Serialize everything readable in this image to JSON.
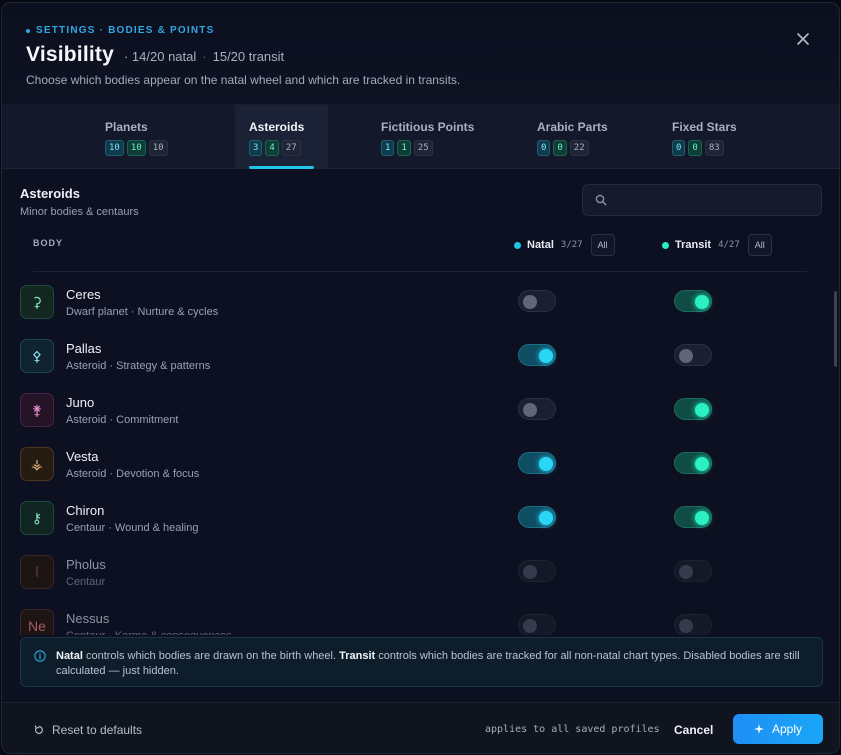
{
  "header": {
    "eyebrow": "SETTINGS · BODIES & POINTS",
    "title": "Visibility",
    "natal_count": "· 14/20 natal",
    "transit_count": "15/20 transit",
    "subtitle": "Choose which bodies appear on the natal wheel and which are tracked in transits.",
    "close_icon": "close-icon"
  },
  "tabs": [
    {
      "label": "Planets",
      "natal": "10",
      "transit": "10",
      "total": "10",
      "active": false
    },
    {
      "label": "Asteroids",
      "natal": "3",
      "transit": "4",
      "total": "27",
      "active": true
    },
    {
      "label": "Fictitious Points",
      "natal": "1",
      "transit": "1",
      "total": "25",
      "active": false
    },
    {
      "label": "Arabic Parts",
      "natal": "0",
      "transit": "0",
      "total": "22",
      "active": false
    },
    {
      "label": "Fixed Stars",
      "natal": "0",
      "transit": "0",
      "total": "83",
      "active": false
    }
  ],
  "section": {
    "title": "Asteroids",
    "subtitle": "Minor bodies & centaurs",
    "search_placeholder": ""
  },
  "columns": {
    "body": "BODY",
    "natal": {
      "label": "Natal",
      "count": "3/27",
      "all": "All"
    },
    "transit": {
      "label": "Transit",
      "count": "4/27",
      "all": "All"
    }
  },
  "bodies": [
    {
      "glyph": "⚳",
      "name": "Ceres",
      "desc": "Dwarf planet · Nurture & cycles",
      "natal": false,
      "transit": true,
      "disabled": false
    },
    {
      "glyph": "⚴",
      "name": "Pallas",
      "desc": "Asteroid · Strategy & patterns",
      "natal": true,
      "transit": false,
      "disabled": false
    },
    {
      "glyph": "⚵",
      "name": "Juno",
      "desc": "Asteroid · Commitment",
      "natal": false,
      "transit": true,
      "disabled": false
    },
    {
      "glyph": "⚶",
      "name": "Vesta",
      "desc": "Asteroid · Devotion & focus",
      "natal": true,
      "transit": true,
      "disabled": false
    },
    {
      "glyph": "⚷",
      "name": "Chiron",
      "desc": "Centaur · Wound & healing",
      "natal": true,
      "transit": true,
      "disabled": false
    },
    {
      "glyph": "⦚",
      "name": "Pholus",
      "desc": "Centaur",
      "natal": false,
      "transit": false,
      "disabled": true
    },
    {
      "glyph": "Ne",
      "name": "Nessus",
      "desc": "Centaur · Karma & consequences",
      "natal": false,
      "transit": false,
      "disabled": true
    }
  ],
  "info": {
    "natal_word": "Natal",
    "natal_text": " controls which bodies are drawn on the birth wheel. ",
    "transit_word": "Transit",
    "transit_text": " controls which bodies are tracked for all non-natal chart types. Disabled bodies are still calculated — just hidden."
  },
  "footer": {
    "reset": "Reset to defaults",
    "applies": "applies to all saved profiles",
    "cancel": "Cancel",
    "apply": "Apply"
  },
  "colors": {
    "accent": "#21c5e8",
    "natal": "#2ad6f6",
    "transit": "#2af0c2",
    "apply": "#1f8ef5"
  }
}
